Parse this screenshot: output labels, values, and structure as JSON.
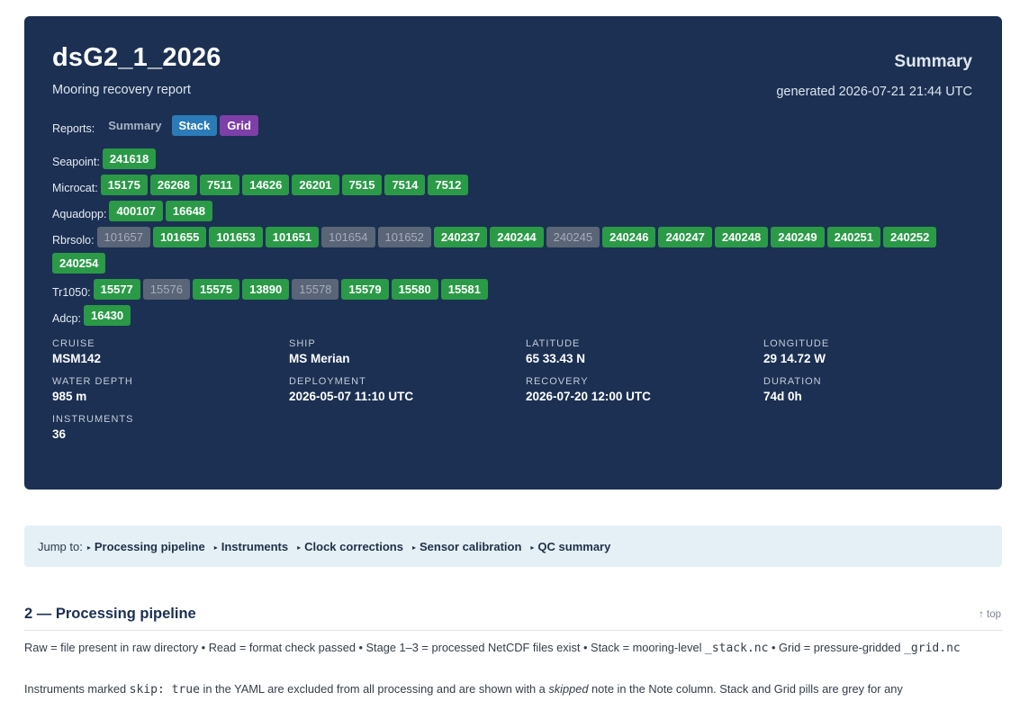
{
  "header": {
    "title": "dsG2_1_2026",
    "subtitle": "Mooring recovery report",
    "report_type": "Summary",
    "generated": "generated 2026-07-21 21:44 UTC"
  },
  "reports": {
    "label": "Reports:",
    "items": [
      {
        "label": "Summary",
        "style": "plain"
      },
      {
        "label": "Stack",
        "style": "blue"
      },
      {
        "label": "Grid",
        "style": "purple"
      }
    ]
  },
  "instrument_groups": [
    {
      "label": "Seapoint:",
      "serials": [
        {
          "id": "241618",
          "skipped": false
        }
      ]
    },
    {
      "label": "Microcat:",
      "serials": [
        {
          "id": "15175",
          "skipped": false
        },
        {
          "id": "26268",
          "skipped": false
        },
        {
          "id": "7511",
          "skipped": false
        },
        {
          "id": "14626",
          "skipped": false
        },
        {
          "id": "26201",
          "skipped": false
        },
        {
          "id": "7515",
          "skipped": false
        },
        {
          "id": "7514",
          "skipped": false
        },
        {
          "id": "7512",
          "skipped": false
        }
      ]
    },
    {
      "label": "Aquadopp:",
      "serials": [
        {
          "id": "400107",
          "skipped": false
        },
        {
          "id": "16648",
          "skipped": false
        }
      ]
    },
    {
      "label": "Rbrsolo:",
      "serials": [
        {
          "id": "101657",
          "skipped": true
        },
        {
          "id": "101655",
          "skipped": false
        },
        {
          "id": "101653",
          "skipped": false
        },
        {
          "id": "101651",
          "skipped": false
        },
        {
          "id": "101654",
          "skipped": true
        },
        {
          "id": "101652",
          "skipped": true
        },
        {
          "id": "240237",
          "skipped": false
        },
        {
          "id": "240244",
          "skipped": false
        },
        {
          "id": "240245",
          "skipped": true
        },
        {
          "id": "240246",
          "skipped": false
        },
        {
          "id": "240247",
          "skipped": false
        },
        {
          "id": "240248",
          "skipped": false
        },
        {
          "id": "240249",
          "skipped": false
        },
        {
          "id": "240251",
          "skipped": false
        },
        {
          "id": "240252",
          "skipped": false
        },
        {
          "id": "240254",
          "skipped": false
        }
      ]
    },
    {
      "label": "Tr1050:",
      "serials": [
        {
          "id": "15577",
          "skipped": false
        },
        {
          "id": "15576",
          "skipped": true
        },
        {
          "id": "15575",
          "skipped": false
        },
        {
          "id": "13890",
          "skipped": false
        },
        {
          "id": "15578",
          "skipped": true
        },
        {
          "id": "15579",
          "skipped": false
        },
        {
          "id": "15580",
          "skipped": false
        },
        {
          "id": "15581",
          "skipped": false
        }
      ]
    },
    {
      "label": "Adcp:",
      "serials": [
        {
          "id": "16430",
          "skipped": false
        }
      ]
    }
  ],
  "metadata": [
    {
      "key": "CRUISE",
      "value": "MSM142"
    },
    {
      "key": "SHIP",
      "value": "MS Merian"
    },
    {
      "key": "LATITUDE",
      "value": "65 33.43 N"
    },
    {
      "key": "LONGITUDE",
      "value": "29 14.72 W"
    },
    {
      "key": "WATER DEPTH",
      "value": "985 m"
    },
    {
      "key": "DEPLOYMENT",
      "value": "2026-05-07 11:10 UTC"
    },
    {
      "key": "RECOVERY",
      "value": "2026-07-20 12:00 UTC"
    },
    {
      "key": "DURATION",
      "value": "74d 0h"
    },
    {
      "key": "INSTRUMENTS",
      "value": "36"
    }
  ],
  "jump": {
    "label": "Jump to:",
    "links": [
      "Processing pipeline",
      "Instruments",
      "Clock corrections",
      "Sensor calibration",
      "QC summary"
    ]
  },
  "section": {
    "title": "2 — Processing pipeline",
    "top_link": "↑ top",
    "legend_part1": "Raw = file present in raw directory • Read = format check passed • Stage 1–3 = processed NetCDF files exist • Stack = mooring-level ",
    "legend_code1": "_stack.nc",
    "legend_part2": " • Grid = pressure-gridded ",
    "legend_code2": "_grid.nc",
    "note_part1": "Instruments marked ",
    "note_code": "skip: true",
    "note_part2": " in the YAML are excluded from all processing and are shown with a ",
    "note_em": "skipped",
    "note_part3": " note in the Note column. Stack and Grid pills are grey for any"
  },
  "colors": {
    "header_bg": "#1b3052",
    "pill_ok": "#2a9a47",
    "pill_skipped": "#5a6577",
    "pill_stack": "#2b7bb9",
    "pill_grid": "#7e3fa8",
    "jump_bg": "#e4f0f6"
  }
}
